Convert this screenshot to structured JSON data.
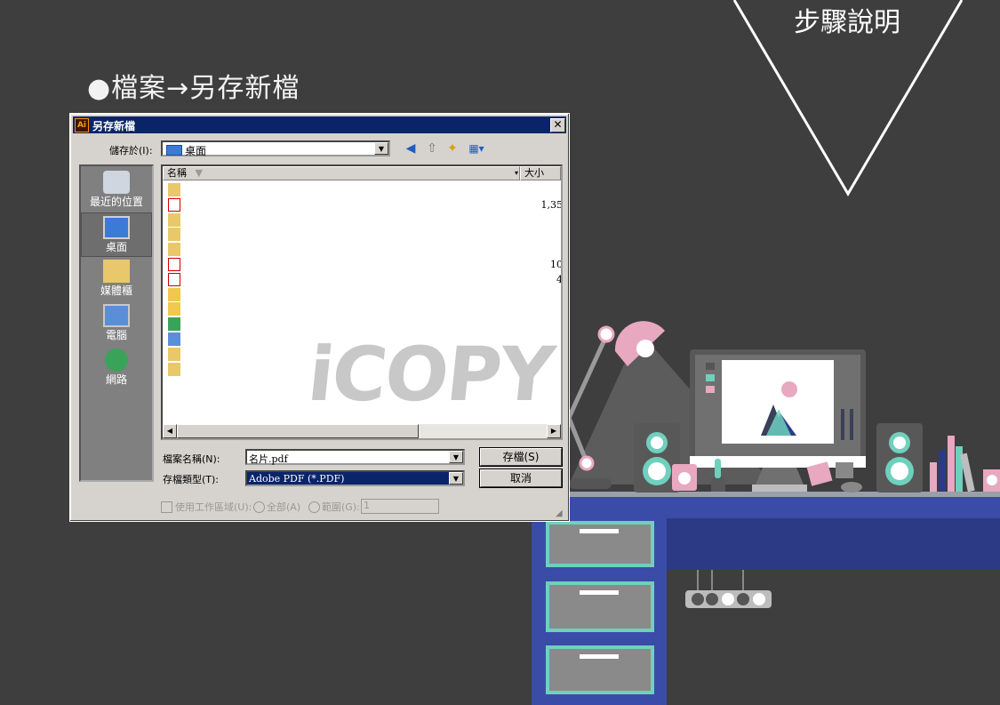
{
  "heading": "●檔案→另存新檔",
  "corner_title": "步驟說明",
  "dialog": {
    "app_icon": "Ai",
    "title": "另存新檔",
    "close_glyph": "✕",
    "save_in_label": "儲存於(I):",
    "save_in_value": "桌面",
    "places": [
      {
        "label": "最近的位置",
        "icon": "recent-places-icon"
      },
      {
        "label": "桌面",
        "icon": "desktop-icon"
      },
      {
        "label": "媒體櫃",
        "icon": "libraries-icon"
      },
      {
        "label": "電腦",
        "icon": "computer-icon"
      },
      {
        "label": "網路",
        "icon": "network-icon"
      }
    ],
    "columns": {
      "name": "名稱",
      "size": "大小"
    },
    "files": [
      {
        "icon": "shortcut-icon",
        "size": ""
      },
      {
        "icon": "pdf-icon",
        "size": "1,35"
      },
      {
        "icon": "shortcut-icon",
        "size": ""
      },
      {
        "icon": "shortcut-icon",
        "size": ""
      },
      {
        "icon": "shortcut-icon",
        "size": ""
      },
      {
        "icon": "pdf-icon",
        "size": "10"
      },
      {
        "icon": "pdf-icon",
        "size": "4"
      },
      {
        "icon": "folder-icon",
        "size": ""
      },
      {
        "icon": "folder-icon",
        "size": ""
      },
      {
        "icon": "network-icon",
        "size": ""
      },
      {
        "icon": "computer-icon",
        "size": ""
      },
      {
        "icon": "user-folder-icon",
        "size": ""
      },
      {
        "icon": "libraries-icon",
        "size": ""
      }
    ],
    "filename_label": "檔案名稱(N):",
    "filename_value": "名片.pdf",
    "filetype_label": "存檔類型(T):",
    "filetype_value": "Adobe PDF (*.PDF)",
    "save_button": "存檔(S)",
    "cancel_button": "取消",
    "use_artboards_label": "使用工作區域(U):",
    "all_label": "全部(A)",
    "range_label": "範圍(G):",
    "range_value": "1"
  },
  "watermark": "iCOPY",
  "colors": {
    "background": "#3e3e3e",
    "titlebar": "#0a246a",
    "dialog_face": "#d6d3ce",
    "desk_blue": "#3a4ca8",
    "lamp_pink": "#e8a8c0",
    "teal": "#6fd0bd"
  }
}
